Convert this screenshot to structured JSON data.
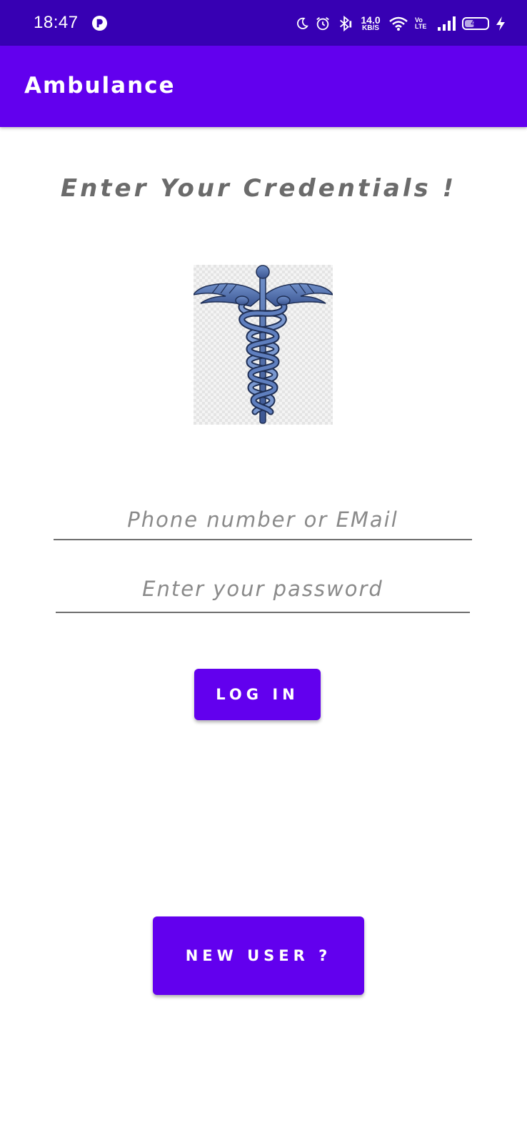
{
  "status_bar": {
    "time": "18:47",
    "speed_value": "14.0",
    "speed_unit": "KB/S",
    "volte_top": "Vo",
    "volte_bottom": "LTE",
    "battery_level": "42",
    "battery_percent": 42,
    "icons": [
      "app-notification-icon",
      "moon-icon",
      "alarm-icon",
      "bluetooth-icon",
      "wifi-icon",
      "signal-icon",
      "battery-icon",
      "charging-icon"
    ]
  },
  "app_bar": {
    "title": "Ambulance"
  },
  "login": {
    "heading": "Enter Your Credentials !",
    "logo": "caduceus-logo",
    "phone_email": {
      "placeholder": "Phone number or EMail",
      "value": ""
    },
    "password": {
      "placeholder": "Enter your password",
      "value": ""
    },
    "login_button": "LOG IN",
    "new_user_button": "NEW USER ?"
  },
  "colors": {
    "status_bar": "#3700B3",
    "app_bar": "#6200EE",
    "button": "#6200EE",
    "heading_text": "#6b6b6b",
    "hint_text": "#8a8a8a"
  }
}
